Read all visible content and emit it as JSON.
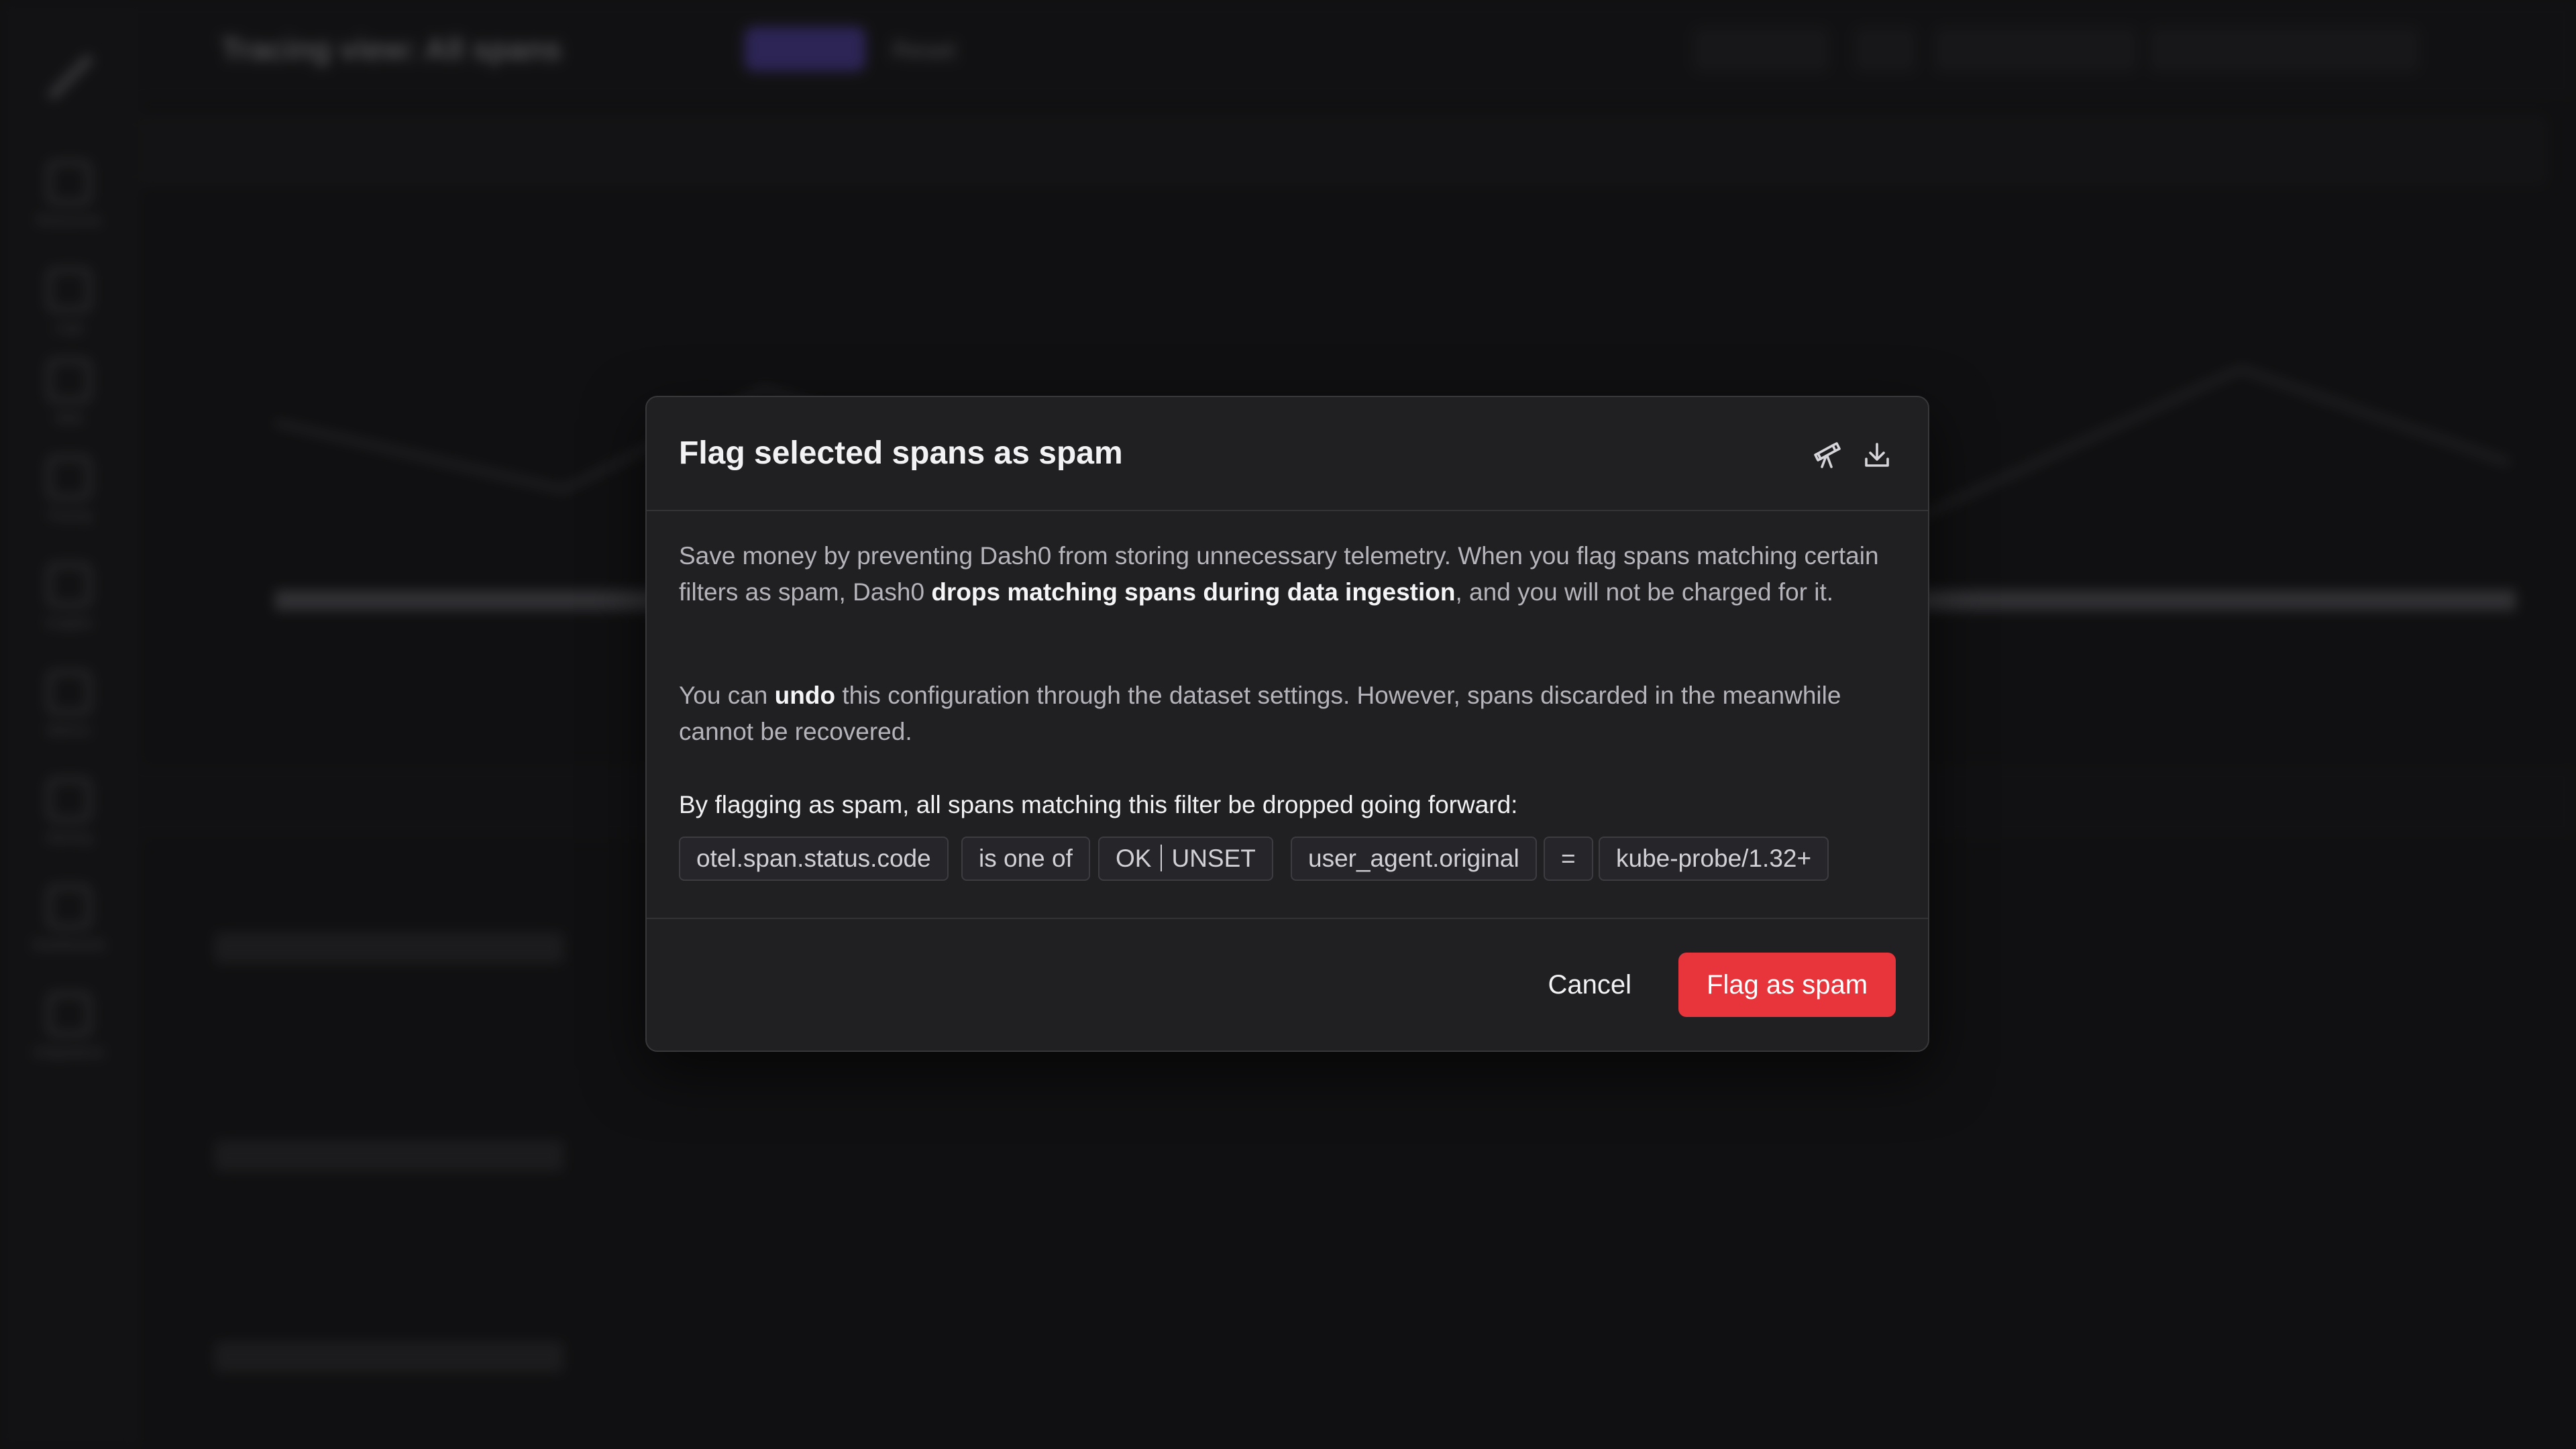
{
  "background": {
    "title": "Tracing view: All spans",
    "reset_label": "Reset",
    "rail_items": [
      "Resources",
      "Logs",
      "Web",
      "Tracing",
      "Insights",
      "Metrics",
      "Alerting",
      "Dashboards",
      "Integrations"
    ]
  },
  "modal": {
    "title": "Flag selected spans as spam",
    "header_icons": [
      "telescope-icon",
      "download-icon"
    ],
    "paragraph1": {
      "pre": "Save money by preventing Dash0 from storing unnecessary telemetry. When you flag spans matching certain filters as spam, Dash0 ",
      "bold": "drops matching spans during data ingestion",
      "post": ", and you will not be charged for it."
    },
    "paragraph2": {
      "pre": "You can ",
      "bold": "undo",
      "post": " this configuration through the dataset settings. However, spans discarded in the meanwhile cannot be recovered."
    },
    "filter_intro": "By flagging as spam, all spans matching this filter be dropped going forward:",
    "filters": [
      {
        "key": "otel.span.status.code",
        "operator": "is one of",
        "values": [
          "OK",
          "UNSET"
        ]
      },
      {
        "key": "user_agent.original",
        "operator": "=",
        "value": "kube-probe/1.32+"
      }
    ],
    "cancel_label": "Cancel",
    "confirm_label": "Flag as spam",
    "colors": {
      "confirm": "#e8353c",
      "accent": "#6d56e8"
    }
  }
}
